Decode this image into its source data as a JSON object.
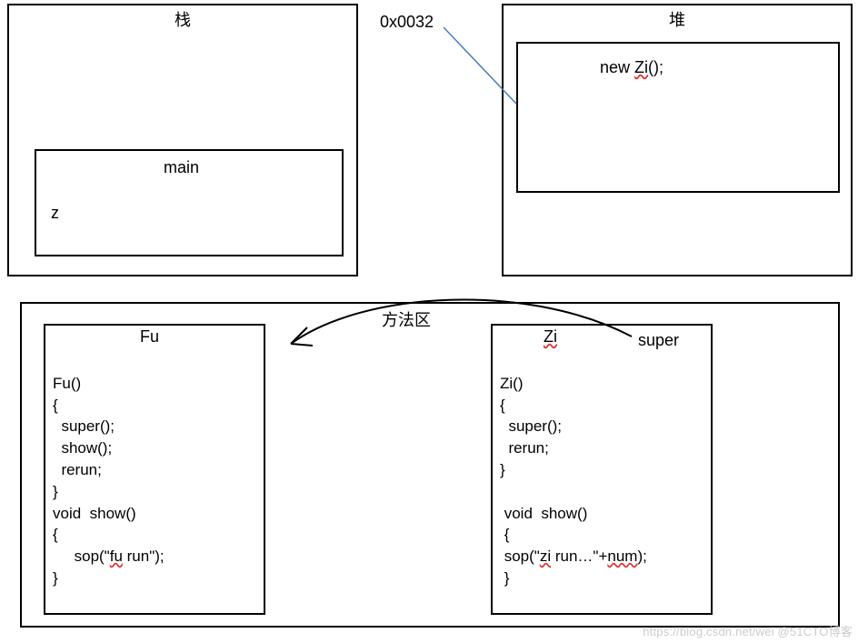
{
  "stack": {
    "title": "栈",
    "main_label": "main",
    "var_label": "z"
  },
  "heap": {
    "title": "堆",
    "address_label": "0x0032",
    "object_expr_pre": "new  ",
    "object_expr_zi": "Zi",
    "object_expr_post": "();"
  },
  "method_area": {
    "title": "方法区",
    "fu": {
      "title": "Fu",
      "code_lines": [
        "Fu()",
        "{",
        "  super();",
        "  show();",
        "  rerun;",
        "}",
        "void  show()",
        "{"
      ],
      "sop_pre": "     sop(\"",
      "sop_fu": "fu",
      "sop_post": " run\");",
      "close": "}"
    },
    "zi": {
      "title": "Zi",
      "super_label": "super",
      "code_lines": [
        "Zi()",
        "{",
        "  super();",
        "  rerun;",
        "}",
        "",
        " void  show()",
        " {"
      ],
      "sop_pre": " sop(\"",
      "sop_zi": "zi",
      "sop_mid": " run…\"+",
      "sop_num": "num",
      "sop_post": ");",
      "close": " }"
    }
  },
  "watermark": "https://blog.csdn.net/wei  @51CTO博客"
}
